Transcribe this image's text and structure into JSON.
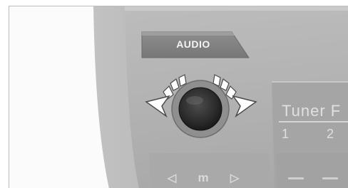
{
  "audio_button": {
    "label": "AUDIO"
  },
  "knob": {
    "icon": "rotary-knob-icon",
    "arrow_left": "rotate-left-arrow-icon",
    "arrow_right": "rotate-right-arrow-icon"
  },
  "tuner": {
    "title": "Tuner F",
    "presets": [
      "1",
      "2"
    ]
  },
  "transport": {
    "prev_icon": "◁",
    "menu_label": "m",
    "next_icon": "▷",
    "dash_1": "—",
    "dash_2": "—"
  },
  "colors": {
    "panel": "#b5b5b5",
    "panel_dark": "#9c9c9c",
    "knob": "#2e2e2e",
    "arrow_fill": "#ffffff",
    "arrow_stroke": "#4a4a4a"
  }
}
